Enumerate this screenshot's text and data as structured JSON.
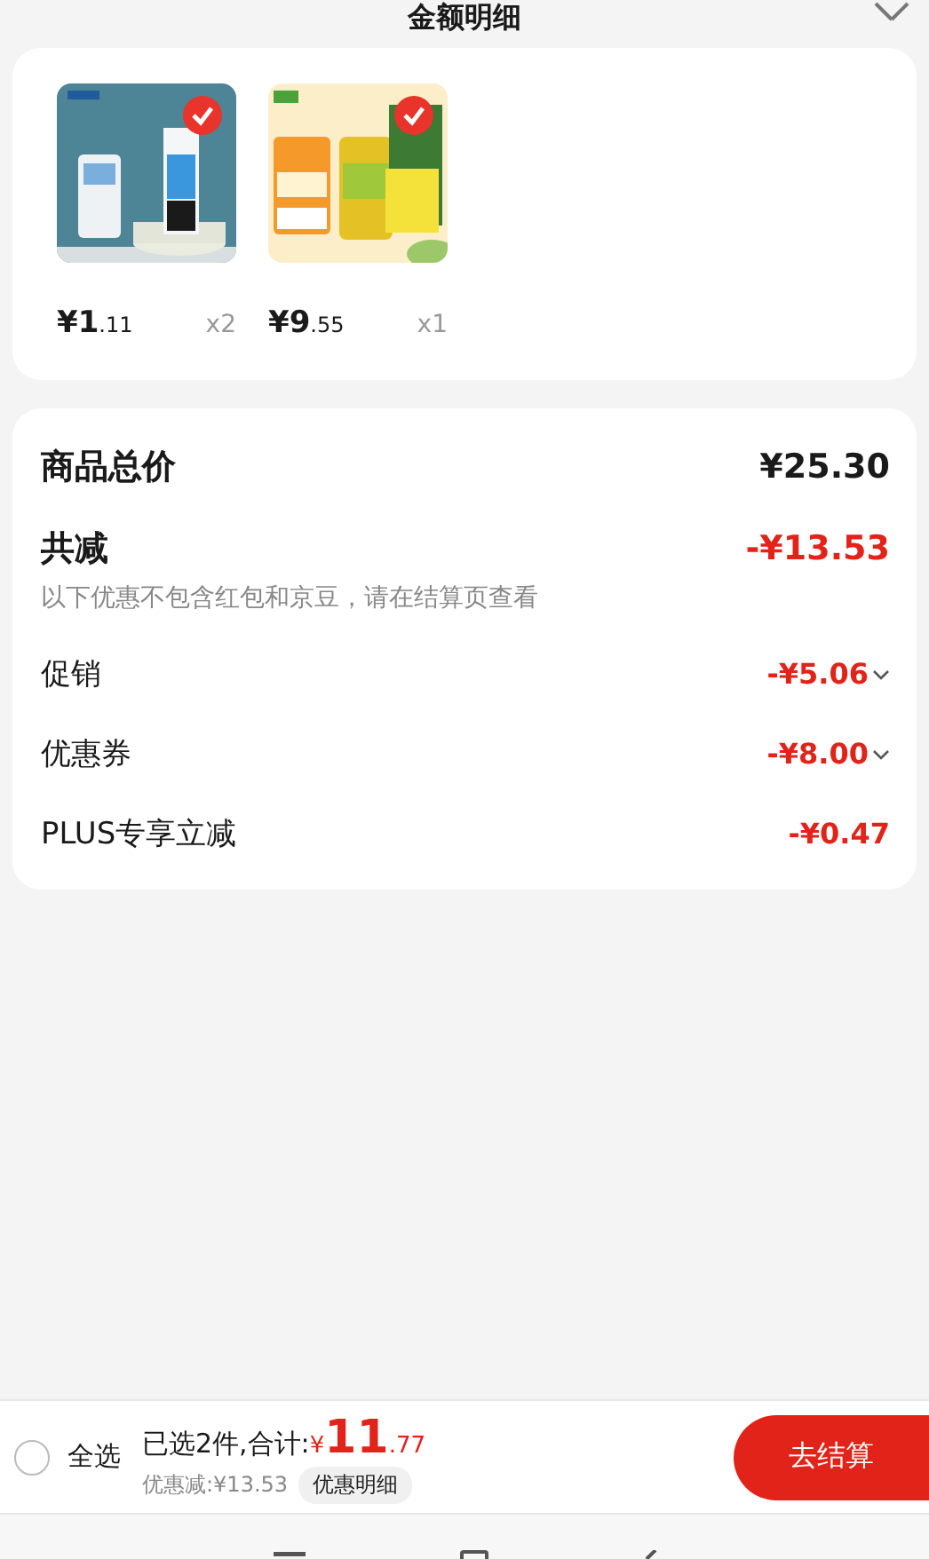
{
  "header": {
    "title": "金额明细"
  },
  "products": [
    {
      "price_main": "¥1",
      "price_decimal": ".11",
      "quantity": "x2",
      "selected": true
    },
    {
      "price_main": "¥9",
      "price_decimal": ".55",
      "quantity": "x1",
      "selected": true
    }
  ],
  "summary": {
    "total_label": "商品总价",
    "total_value": "¥25.30",
    "discount_label": "共减",
    "discount_value": "-¥13.53",
    "note": "以下优惠不包含红包和京豆，请在结算页查看",
    "items": [
      {
        "label": "促销",
        "value": "-¥5.06",
        "expandable": true
      },
      {
        "label": "优惠券",
        "value": "-¥8.00",
        "expandable": true
      },
      {
        "label": "PLUS专享立减",
        "value": "-¥0.47",
        "expandable": false
      }
    ]
  },
  "bottom_bar": {
    "select_all": {
      "label": "全选",
      "checked": false
    },
    "selected_text": "已选2件,合计:",
    "currency": "¥",
    "total_main": "11",
    "total_decimal": ".77",
    "saved_text": "优惠减:¥13.53",
    "detail_button": "优惠明细",
    "checkout_button": "去结算"
  }
}
